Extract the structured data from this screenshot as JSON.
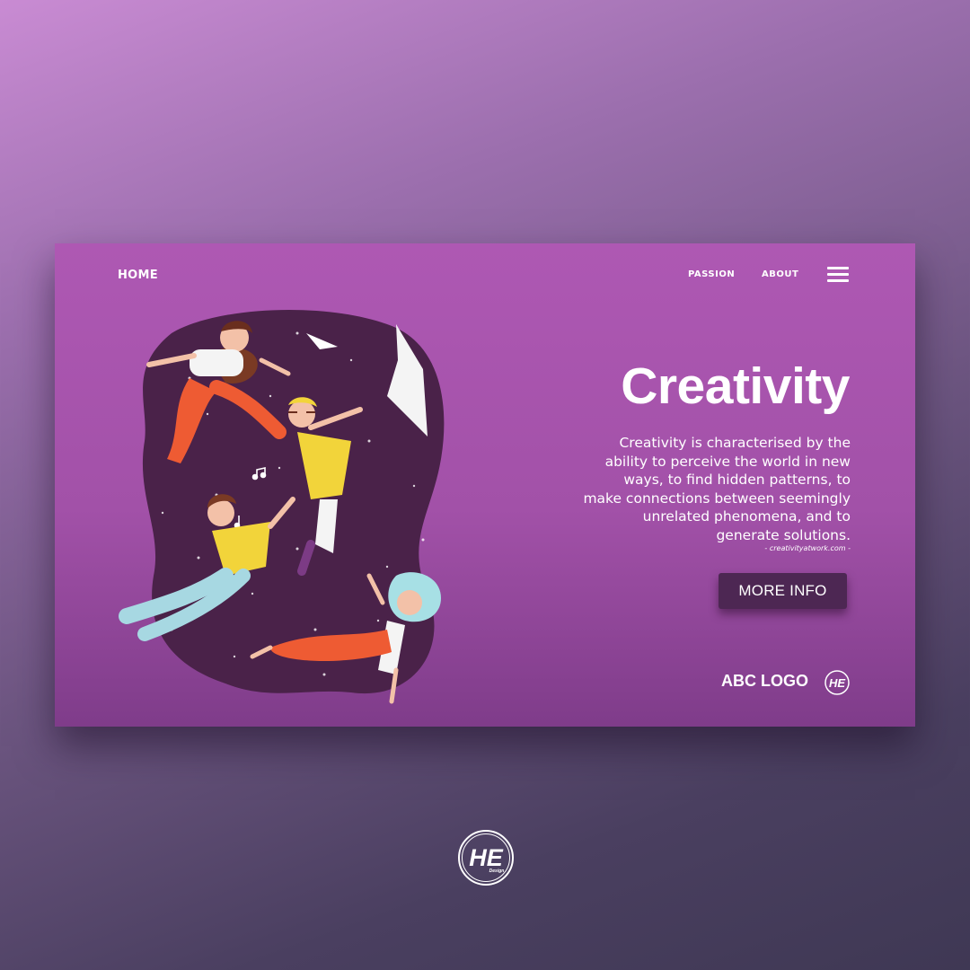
{
  "nav": {
    "home": "HOME",
    "passion": "PASSION",
    "about": "ABOUT"
  },
  "hero": {
    "title": "Creativity",
    "description": "Creativity is characterised by the ability to perceive the world in new ways, to find hidden patterns, to make connections between seemingly unrelated phenomena, and to generate solutions.",
    "source": "- creativityatwork.com -",
    "button_label": "MORE INFO"
  },
  "footer": {
    "logo_text": "ABC LOGO",
    "logo_mark": "HE"
  },
  "watermark": {
    "mark": "HE",
    "sub": "Design"
  },
  "icons": {
    "menu": "hamburger-icon",
    "logo": "he-monogram-icon"
  },
  "colors": {
    "card": "#ae58b3",
    "button": "#4d2753",
    "illustration_blob": "#4a2249"
  }
}
